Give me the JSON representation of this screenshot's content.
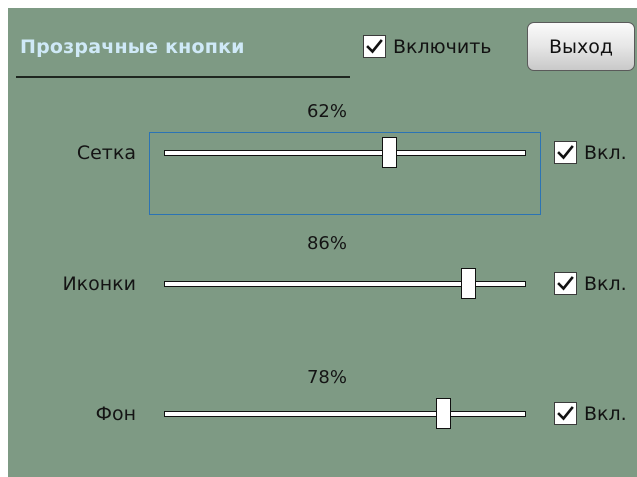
{
  "header": {
    "title": "Прозрачные кнопки",
    "enable_label": "Включить",
    "enable_checked": true,
    "exit_label": "Выход"
  },
  "sliders": [
    {
      "label": "Сетка",
      "percent_text": "62%",
      "value": 0.62,
      "on_label": "Вкл.",
      "checked": true
    },
    {
      "label": "Иконки",
      "percent_text": "86%",
      "value": 0.86,
      "on_label": "Вкл.",
      "checked": true
    },
    {
      "label": "Фон",
      "percent_text": "78%",
      "value": 0.78,
      "on_label": "Вкл.",
      "checked": true
    }
  ],
  "colors": {
    "panel_bg": "#7e9a84",
    "title": "#cfe9f7",
    "focus_border": "#2c73b4"
  },
  "icons": {
    "checkmark": "checkmark-icon"
  }
}
